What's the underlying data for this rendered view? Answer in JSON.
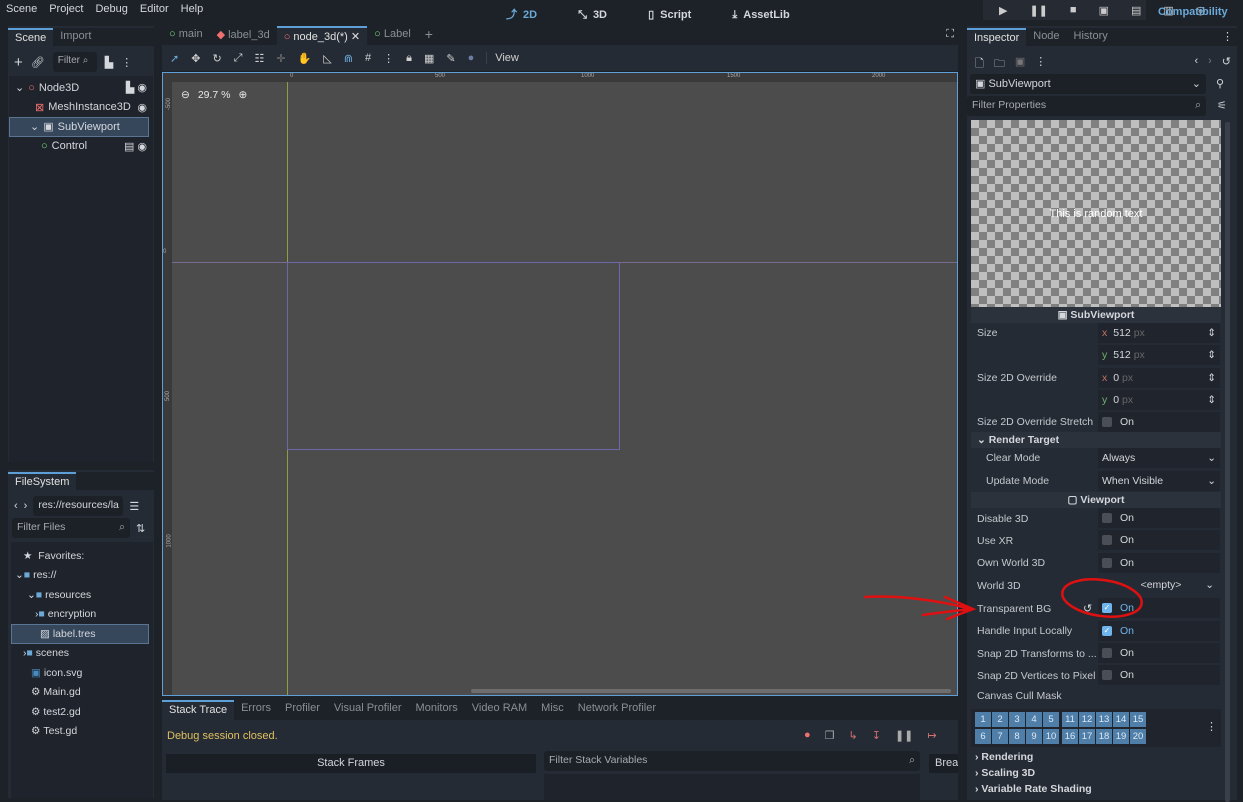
{
  "menu": [
    "Scene",
    "Project",
    "Debug",
    "Editor",
    "Help"
  ],
  "modes": [
    "2D",
    "3D",
    "Script",
    "AssetLib"
  ],
  "renderer": "Compatibility",
  "scene_dock": {
    "tabs": [
      "Scene",
      "Import"
    ],
    "filter_placeholder": "Filter",
    "nodes": [
      {
        "name": "Node3D",
        "color": "#f07070"
      },
      {
        "name": "MeshInstance3D",
        "color": "#f07070"
      },
      {
        "name": "SubViewport",
        "color": "#c8c8c8"
      },
      {
        "name": "Control",
        "color": "#7ddc7d"
      }
    ]
  },
  "filesystem": {
    "tab": "FileSystem",
    "path": "res://resources/la",
    "filter_placeholder": "Filter Files",
    "items": [
      "Favorites:",
      "res://",
      "resources",
      "encryption",
      "label.tres",
      "scenes",
      "icon.svg",
      "Main.gd",
      "test2.gd",
      "Test.gd"
    ]
  },
  "editor_tabs": [
    "main",
    "label_3d",
    "node_3d(*)",
    "Label"
  ],
  "toolbar": {
    "view": "View"
  },
  "viewport": {
    "zoom": "29.7 %",
    "ruler": [
      "0",
      "500",
      "1000",
      "1500",
      "2000"
    ],
    "ruler_v": [
      "-500",
      "0",
      "500",
      "1000"
    ]
  },
  "bottom": {
    "tabs": [
      "Stack Trace",
      "Errors",
      "Profiler",
      "Visual Profiler",
      "Monitors",
      "Video RAM",
      "Misc",
      "Network Profiler"
    ],
    "status": "Debug session closed.",
    "stack_frames": "Stack Frames",
    "filter_vars": "Filter Stack Variables",
    "breakpoints": "Brea"
  },
  "inspector": {
    "tabs": [
      "Inspector",
      "Node",
      "History"
    ],
    "object": "SubViewport",
    "filter_placeholder": "Filter Properties",
    "preview_text": "This is random text",
    "section": "SubViewport",
    "size": {
      "label": "Size",
      "x": "512",
      "y": "512",
      "unit": "px"
    },
    "size2d": {
      "label": "Size 2D Override",
      "x": "0",
      "y": "0",
      "unit": "px"
    },
    "stretch": {
      "label": "Size 2D Override Stretch",
      "value": "On"
    },
    "render_target": {
      "label": "Render Target",
      "clear_label": "Clear Mode",
      "clear": "Always",
      "update_label": "Update Mode",
      "update": "When Visible"
    },
    "viewport_section": "Viewport",
    "props": [
      {
        "label": "Disable 3D",
        "value": "On",
        "checked": false
      },
      {
        "label": "Use XR",
        "value": "On",
        "checked": false
      },
      {
        "label": "Own World 3D",
        "value": "On",
        "checked": false
      }
    ],
    "world3d": {
      "label": "World 3D",
      "value": "<empty>"
    },
    "props2": [
      {
        "label": "Transparent BG",
        "value": "On",
        "checked": true
      },
      {
        "label": "Handle Input Locally",
        "value": "On",
        "checked": true
      },
      {
        "label": "Snap 2D Transforms to ...",
        "value": "On",
        "checked": false
      },
      {
        "label": "Snap 2D Vertices to Pixel",
        "value": "On",
        "checked": false
      }
    ],
    "cull_mask": "Canvas Cull Mask",
    "mask_a": [
      "1",
      "2",
      "3",
      "4",
      "5",
      "6",
      "7",
      "8",
      "9",
      "10"
    ],
    "mask_b": [
      "11",
      "12",
      "13",
      "14",
      "15",
      "16",
      "17",
      "18",
      "19",
      "20"
    ],
    "groups": [
      "Rendering",
      "Scaling 3D",
      "Variable Rate Shading"
    ]
  }
}
